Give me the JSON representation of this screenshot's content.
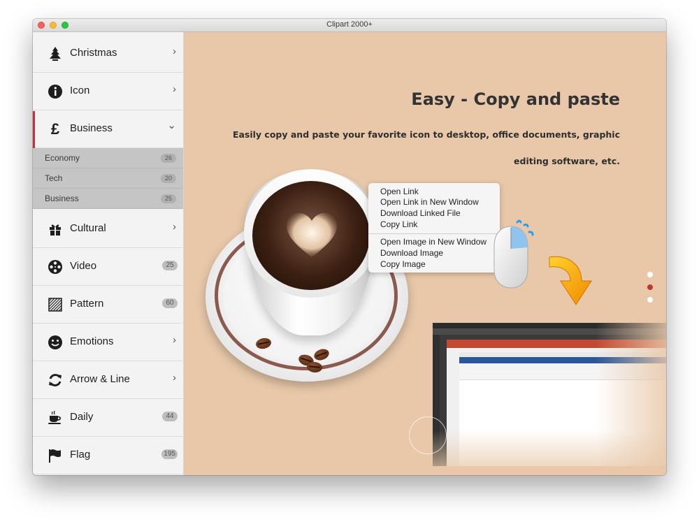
{
  "window": {
    "title": "Clipart 2000+"
  },
  "sidebar": {
    "categories": [
      {
        "label": "Christmas",
        "icon": "tree-icon",
        "chevron": "›"
      },
      {
        "label": "Icon",
        "icon": "info-icon",
        "chevron": "›"
      },
      {
        "label": "Business",
        "icon": "pound-icon",
        "chevron": "⌄",
        "active": true
      },
      {
        "label": "Cultural",
        "icon": "gift-icon",
        "chevron": "›"
      },
      {
        "label": "Video",
        "icon": "film-reel-icon",
        "count": "25"
      },
      {
        "label": "Pattern",
        "icon": "pattern-icon",
        "count": "60"
      },
      {
        "label": "Emotions",
        "icon": "smiley-icon",
        "chevron": "›"
      },
      {
        "label": "Arrow & Line",
        "icon": "refresh-arrows-icon",
        "chevron": "›"
      },
      {
        "label": "Daily",
        "icon": "coffee-cup-icon",
        "count": "44"
      },
      {
        "label": "Flag",
        "icon": "flag-icon",
        "count": "195"
      }
    ],
    "subcategories": [
      {
        "label": "Economy",
        "count": "26"
      },
      {
        "label": "Tech",
        "count": "20"
      },
      {
        "label": "Business",
        "count": "25"
      }
    ]
  },
  "content": {
    "headline": "Easy - Copy and paste",
    "description": "Easily copy and paste your favorite icon to desktop, office documents, graphic editing software, etc."
  },
  "context_menu": {
    "group1": [
      "Open Link",
      "Open Link in New Window",
      "Download Linked File",
      "Copy Link"
    ],
    "group2": [
      "Open Image in New Window",
      "Download Image",
      "Copy Image"
    ]
  },
  "pager": {
    "total": 3,
    "active_index": 1
  },
  "colors": {
    "accent": "#c0343a",
    "content_bg": "#e8c8a9",
    "sidebar_bg": "#f3f3f3"
  }
}
